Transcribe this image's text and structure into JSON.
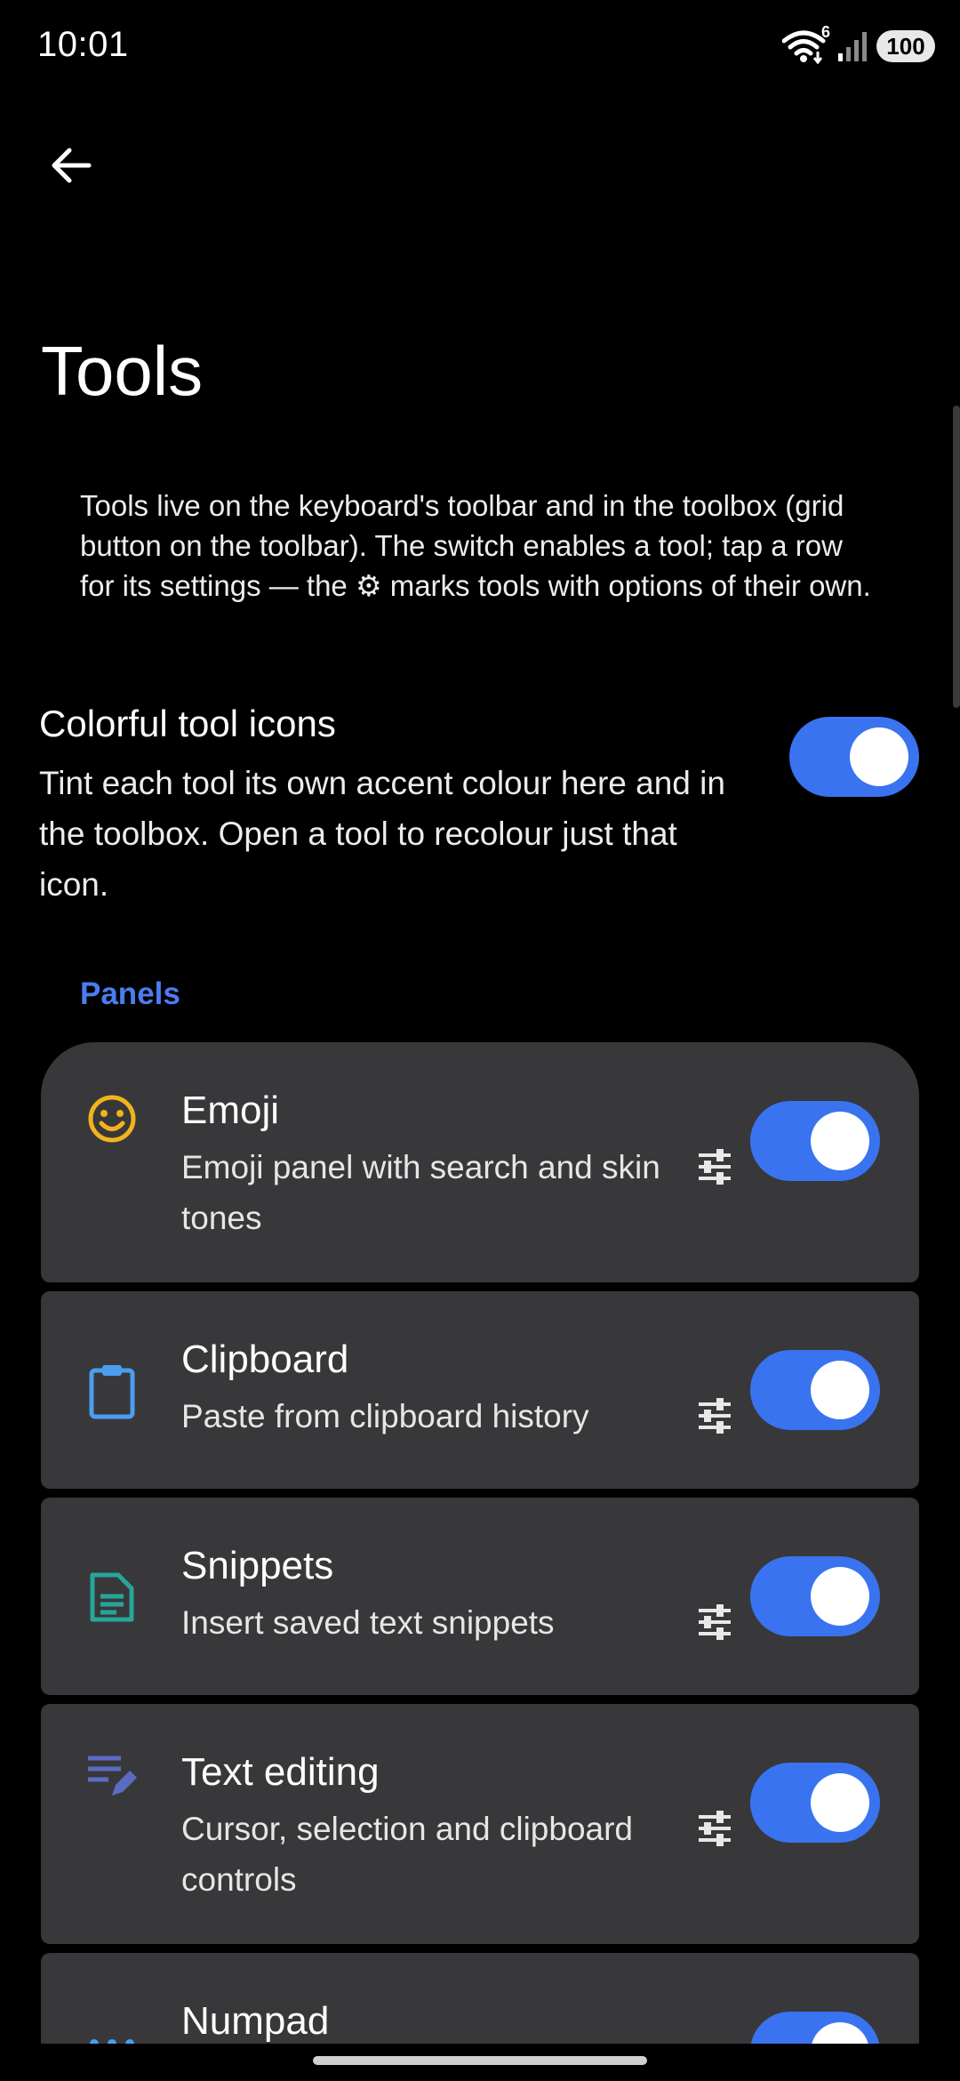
{
  "status_bar": {
    "time": "10:01",
    "wifi_badge": "6",
    "battery": "100",
    "icons": [
      "wifi-icon",
      "signal-icon",
      "battery-icon"
    ]
  },
  "header": {
    "back_icon": "arrow-back-icon",
    "title": "Tools"
  },
  "description": "Tools live on the keyboard's toolbar and in the toolbox (grid button on the toolbar). The switch enables a tool; tap a row for its settings — the ⚙ marks tools with options of their own.",
  "colorful_icons": {
    "title": "Colorful tool icons",
    "description": "Tint each tool its own accent colour here and in the toolbox. Open a tool to recolour just that icon.",
    "enabled": true
  },
  "sections": {
    "panels": {
      "label": "Panels",
      "tools": [
        {
          "name": "Emoji",
          "description": "Emoji panel with search and skin tones",
          "icon": "emoji-icon",
          "color": "#f2b31d",
          "enabled": true
        },
        {
          "name": "Clipboard",
          "description": "Paste from clipboard history",
          "icon": "clipboard-icon",
          "color": "#4a9ef0",
          "enabled": true
        },
        {
          "name": "Snippets",
          "description": "Insert saved text snippets",
          "icon": "snippets-icon",
          "color": "#26a69a",
          "enabled": true
        },
        {
          "name": "Text editing",
          "description": "Cursor, selection and clipboard controls",
          "icon": "text-edit-icon",
          "color": "#5c6bc0",
          "enabled": true
        },
        {
          "name": "Numpad",
          "description": "",
          "icon": "numpad-icon",
          "color": "#4a9ef0",
          "enabled": true
        }
      ]
    }
  },
  "colors": {
    "accent": "#3a73f0",
    "section_header": "#4b7cf0",
    "card": "#38383b",
    "background": "#000000"
  }
}
